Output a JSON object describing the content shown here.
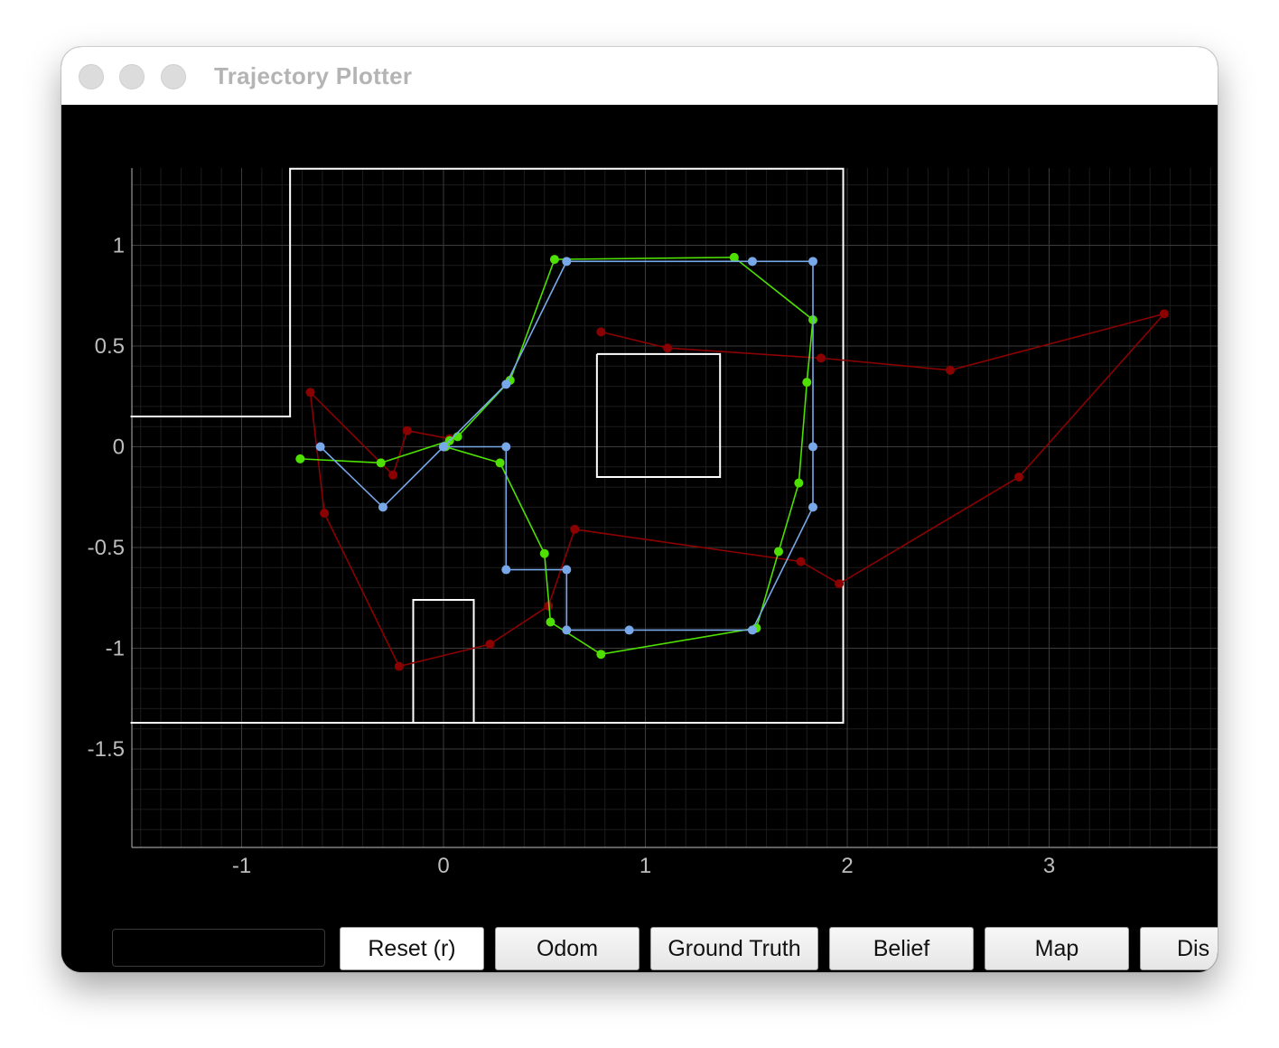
{
  "window": {
    "title": "Trajectory Plotter"
  },
  "toolbar": {
    "input_value": "",
    "buttons": [
      {
        "label": "Reset (r)"
      },
      {
        "label": "Odom"
      },
      {
        "label": "Ground Truth"
      },
      {
        "label": "Belief"
      },
      {
        "label": "Map"
      },
      {
        "label": "Dis"
      }
    ]
  },
  "colors": {
    "background": "#000000",
    "odom": "#8b0000",
    "ground_truth": "#4ee000",
    "belief": "#78a8e8",
    "map": "#ffffff",
    "grid_major": "#3c3c3c",
    "grid_minor": "#1c1c1c",
    "tick_text": "#bdbdbd"
  },
  "chart_data": {
    "type": "line",
    "xlim": [
      -1.6,
      3.8
    ],
    "ylim": [
      -1.98,
      1.38
    ],
    "x_ticks": [
      -1,
      0,
      1,
      2,
      3
    ],
    "x_tick_labels": [
      "-1",
      "0",
      "1",
      "2",
      "3"
    ],
    "y_ticks": [
      1,
      0.5,
      0,
      -0.5,
      -1,
      -1.5
    ],
    "y_tick_labels": [
      "1",
      "0.5",
      "0",
      "-0.5",
      "-1",
      "-1.5"
    ],
    "grid": true,
    "minor_grid_step": 0.1,
    "series": [
      {
        "key": "odom",
        "points": [
          [
            0.78,
            0.57
          ],
          [
            1.11,
            0.49
          ],
          [
            1.87,
            0.44
          ],
          [
            2.51,
            0.38
          ],
          [
            3.57,
            0.66
          ],
          [
            2.85,
            -0.15
          ],
          [
            1.96,
            -0.68
          ],
          [
            1.77,
            -0.57
          ],
          [
            0.65,
            -0.41
          ],
          [
            0.52,
            -0.79
          ],
          [
            0.23,
            -0.98
          ],
          [
            -0.22,
            -1.09
          ],
          [
            -0.59,
            -0.33
          ],
          [
            -0.66,
            0.27
          ],
          [
            -0.25,
            -0.14
          ],
          [
            -0.18,
            0.08
          ],
          [
            0.03,
            0.04
          ]
        ]
      },
      {
        "key": "ground_truth",
        "points": [
          [
            -0.71,
            -0.06
          ],
          [
            -0.31,
            -0.08
          ],
          [
            0.03,
            0.03
          ],
          [
            0.07,
            0.05
          ],
          [
            0.33,
            0.33
          ],
          [
            0.55,
            0.93
          ],
          [
            1.44,
            0.94
          ],
          [
            1.83,
            0.63
          ],
          [
            1.8,
            0.32
          ],
          [
            1.76,
            -0.18
          ],
          [
            1.66,
            -0.52
          ],
          [
            1.55,
            -0.9
          ],
          [
            0.78,
            -1.03
          ],
          [
            0.53,
            -0.87
          ],
          [
            0.5,
            -0.53
          ],
          [
            0.28,
            -0.08
          ],
          [
            0.01,
            0.0
          ]
        ]
      },
      {
        "key": "belief",
        "points": [
          [
            -0.61,
            0.0
          ],
          [
            -0.3,
            -0.3
          ],
          [
            0.0,
            0.0
          ],
          [
            0.31,
            0.31
          ],
          [
            0.61,
            0.92
          ],
          [
            1.53,
            0.92
          ],
          [
            1.83,
            0.92
          ],
          [
            1.83,
            0.0
          ],
          [
            1.83,
            -0.3
          ],
          [
            1.53,
            -0.91
          ],
          [
            0.92,
            -0.91
          ],
          [
            0.61,
            -0.91
          ],
          [
            0.61,
            -0.61
          ],
          [
            0.31,
            -0.61
          ],
          [
            0.31,
            0.0
          ],
          [
            0.0,
            0.0
          ]
        ]
      }
    ],
    "map_polylines": [
      [
        [
          -1.55,
          0.15
        ],
        [
          -0.76,
          0.15
        ],
        [
          -0.76,
          1.38
        ],
        [
          1.98,
          1.38
        ],
        [
          1.98,
          -1.37
        ],
        [
          -1.55,
          -1.37
        ]
      ],
      [
        [
          0.76,
          0.46
        ],
        [
          1.37,
          0.46
        ],
        [
          1.37,
          -0.15
        ],
        [
          0.76,
          -0.15
        ],
        [
          0.76,
          0.46
        ]
      ],
      [
        [
          -0.15,
          -1.37
        ],
        [
          -0.15,
          -0.76
        ],
        [
          0.15,
          -0.76
        ],
        [
          0.15,
          -1.37
        ]
      ]
    ]
  }
}
